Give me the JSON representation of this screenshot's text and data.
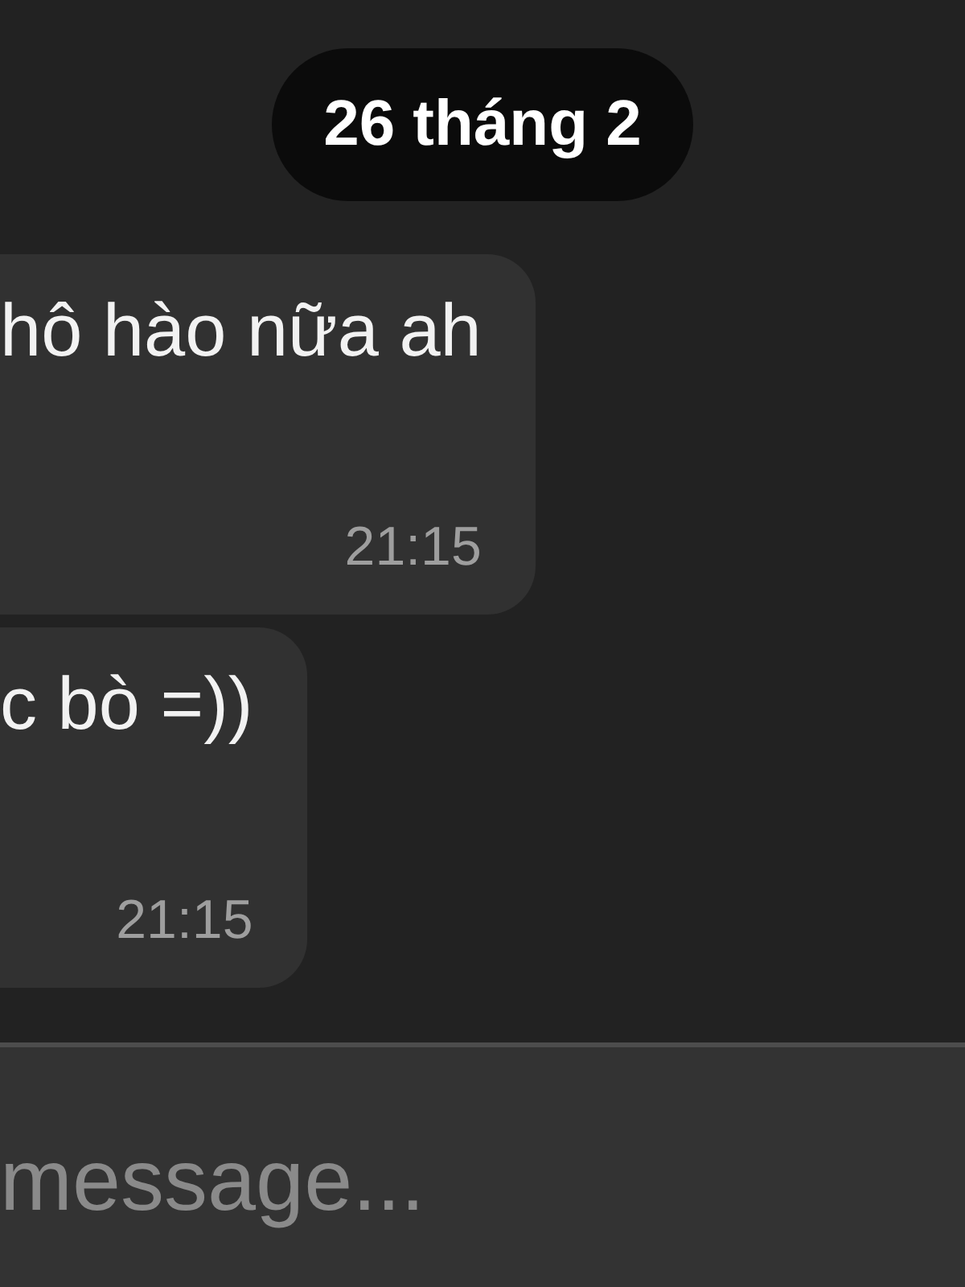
{
  "date_divider": {
    "label": "26 tháng 2"
  },
  "messages": [
    {
      "text": "hô hào nữa ah",
      "time": "21:15"
    },
    {
      "text": "c bò =))",
      "time": "21:15"
    }
  ],
  "composer": {
    "placeholder": "message..."
  }
}
